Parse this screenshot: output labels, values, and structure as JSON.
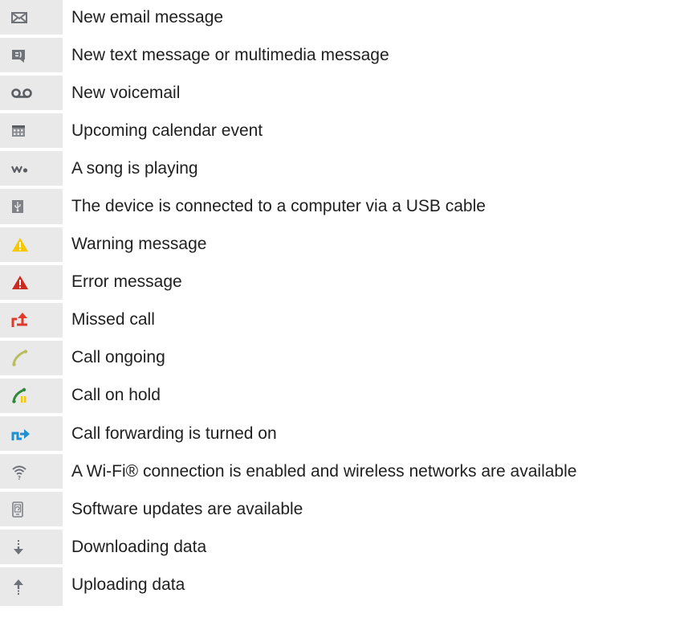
{
  "legend": {
    "rows": [
      {
        "icon": "email-icon",
        "label": "New email message"
      },
      {
        "icon": "text-message-icon",
        "label": "New text message or multimedia message"
      },
      {
        "icon": "voicemail-icon",
        "label": "New voicemail"
      },
      {
        "icon": "calendar-icon",
        "label": "Upcoming calendar event"
      },
      {
        "icon": "walkman-icon",
        "label": "A song is playing"
      },
      {
        "icon": "usb-icon",
        "label": "The device is connected to a computer via a USB cable"
      },
      {
        "icon": "warning-icon",
        "label": "Warning message"
      },
      {
        "icon": "error-icon",
        "label": "Error message"
      },
      {
        "icon": "missed-call-icon",
        "label": "Missed call"
      },
      {
        "icon": "call-ongoing-icon",
        "label": "Call ongoing"
      },
      {
        "icon": "call-on-hold-icon",
        "label": "Call on hold"
      },
      {
        "icon": "call-forwarding-icon",
        "label": "Call forwarding is turned on"
      },
      {
        "icon": "wifi-icon",
        "label": "A Wi-Fi® connection is enabled and wireless networks are available"
      },
      {
        "icon": "software-update-icon",
        "label": "Software updates are available"
      },
      {
        "icon": "downloading-icon",
        "label": "Downloading data"
      },
      {
        "icon": "uploading-icon",
        "label": "Uploading data"
      }
    ]
  },
  "colors": {
    "icon_column_bg": "#e9e9ea",
    "icon_gray": "#6f7378",
    "warning_yellow": "#f6c800",
    "error_red": "#cc2a20",
    "missed_red": "#e03a2a",
    "call_green": "#b9bd5c",
    "hold_green": "#2e8a3a",
    "forward_blue": "#1e8fd0",
    "text": "#1f1f1f"
  }
}
